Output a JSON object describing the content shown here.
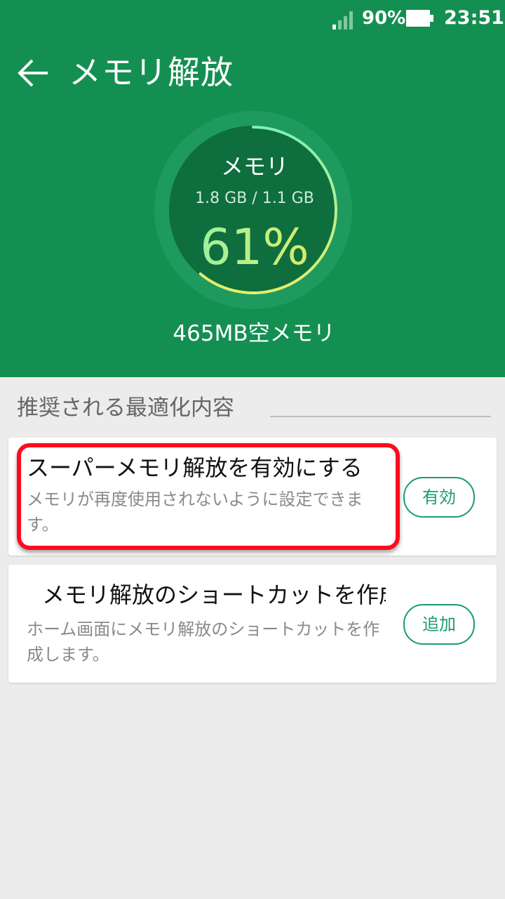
{
  "status_bar": {
    "battery_percent": "90%",
    "time": "23:51",
    "icons": [
      "signal-icon",
      "battery-icon"
    ]
  },
  "header": {
    "title": "メモリ解放",
    "back_icon": "arrow-left-icon"
  },
  "gauge": {
    "label": "メモリ",
    "usage": "1.8 GB / 1.1 GB",
    "percent_text": "61%",
    "percent_value": 61,
    "free_memory": "465MB空メモリ",
    "colors": {
      "start": "#7ff0b7",
      "end": "#f0e24d",
      "track": "#1f9a5e",
      "inner": "#0e6e3e"
    }
  },
  "section": {
    "title": "推奨される最適化内容"
  },
  "cards": [
    {
      "title": "スーパーメモリ解放を有効にする",
      "description": "メモリが再度使用されないように設定できます。",
      "button_label": "有効"
    },
    {
      "title": "メモリ解放のショートカットを作成",
      "description": "ホーム画面にメモリ解放のショートカットを作成します。",
      "button_label": "追加"
    }
  ],
  "colors": {
    "header_green": "#148f52",
    "accent": "#1c9b6a",
    "highlight_red": "#ff0a1e",
    "background": "#ececec"
  }
}
